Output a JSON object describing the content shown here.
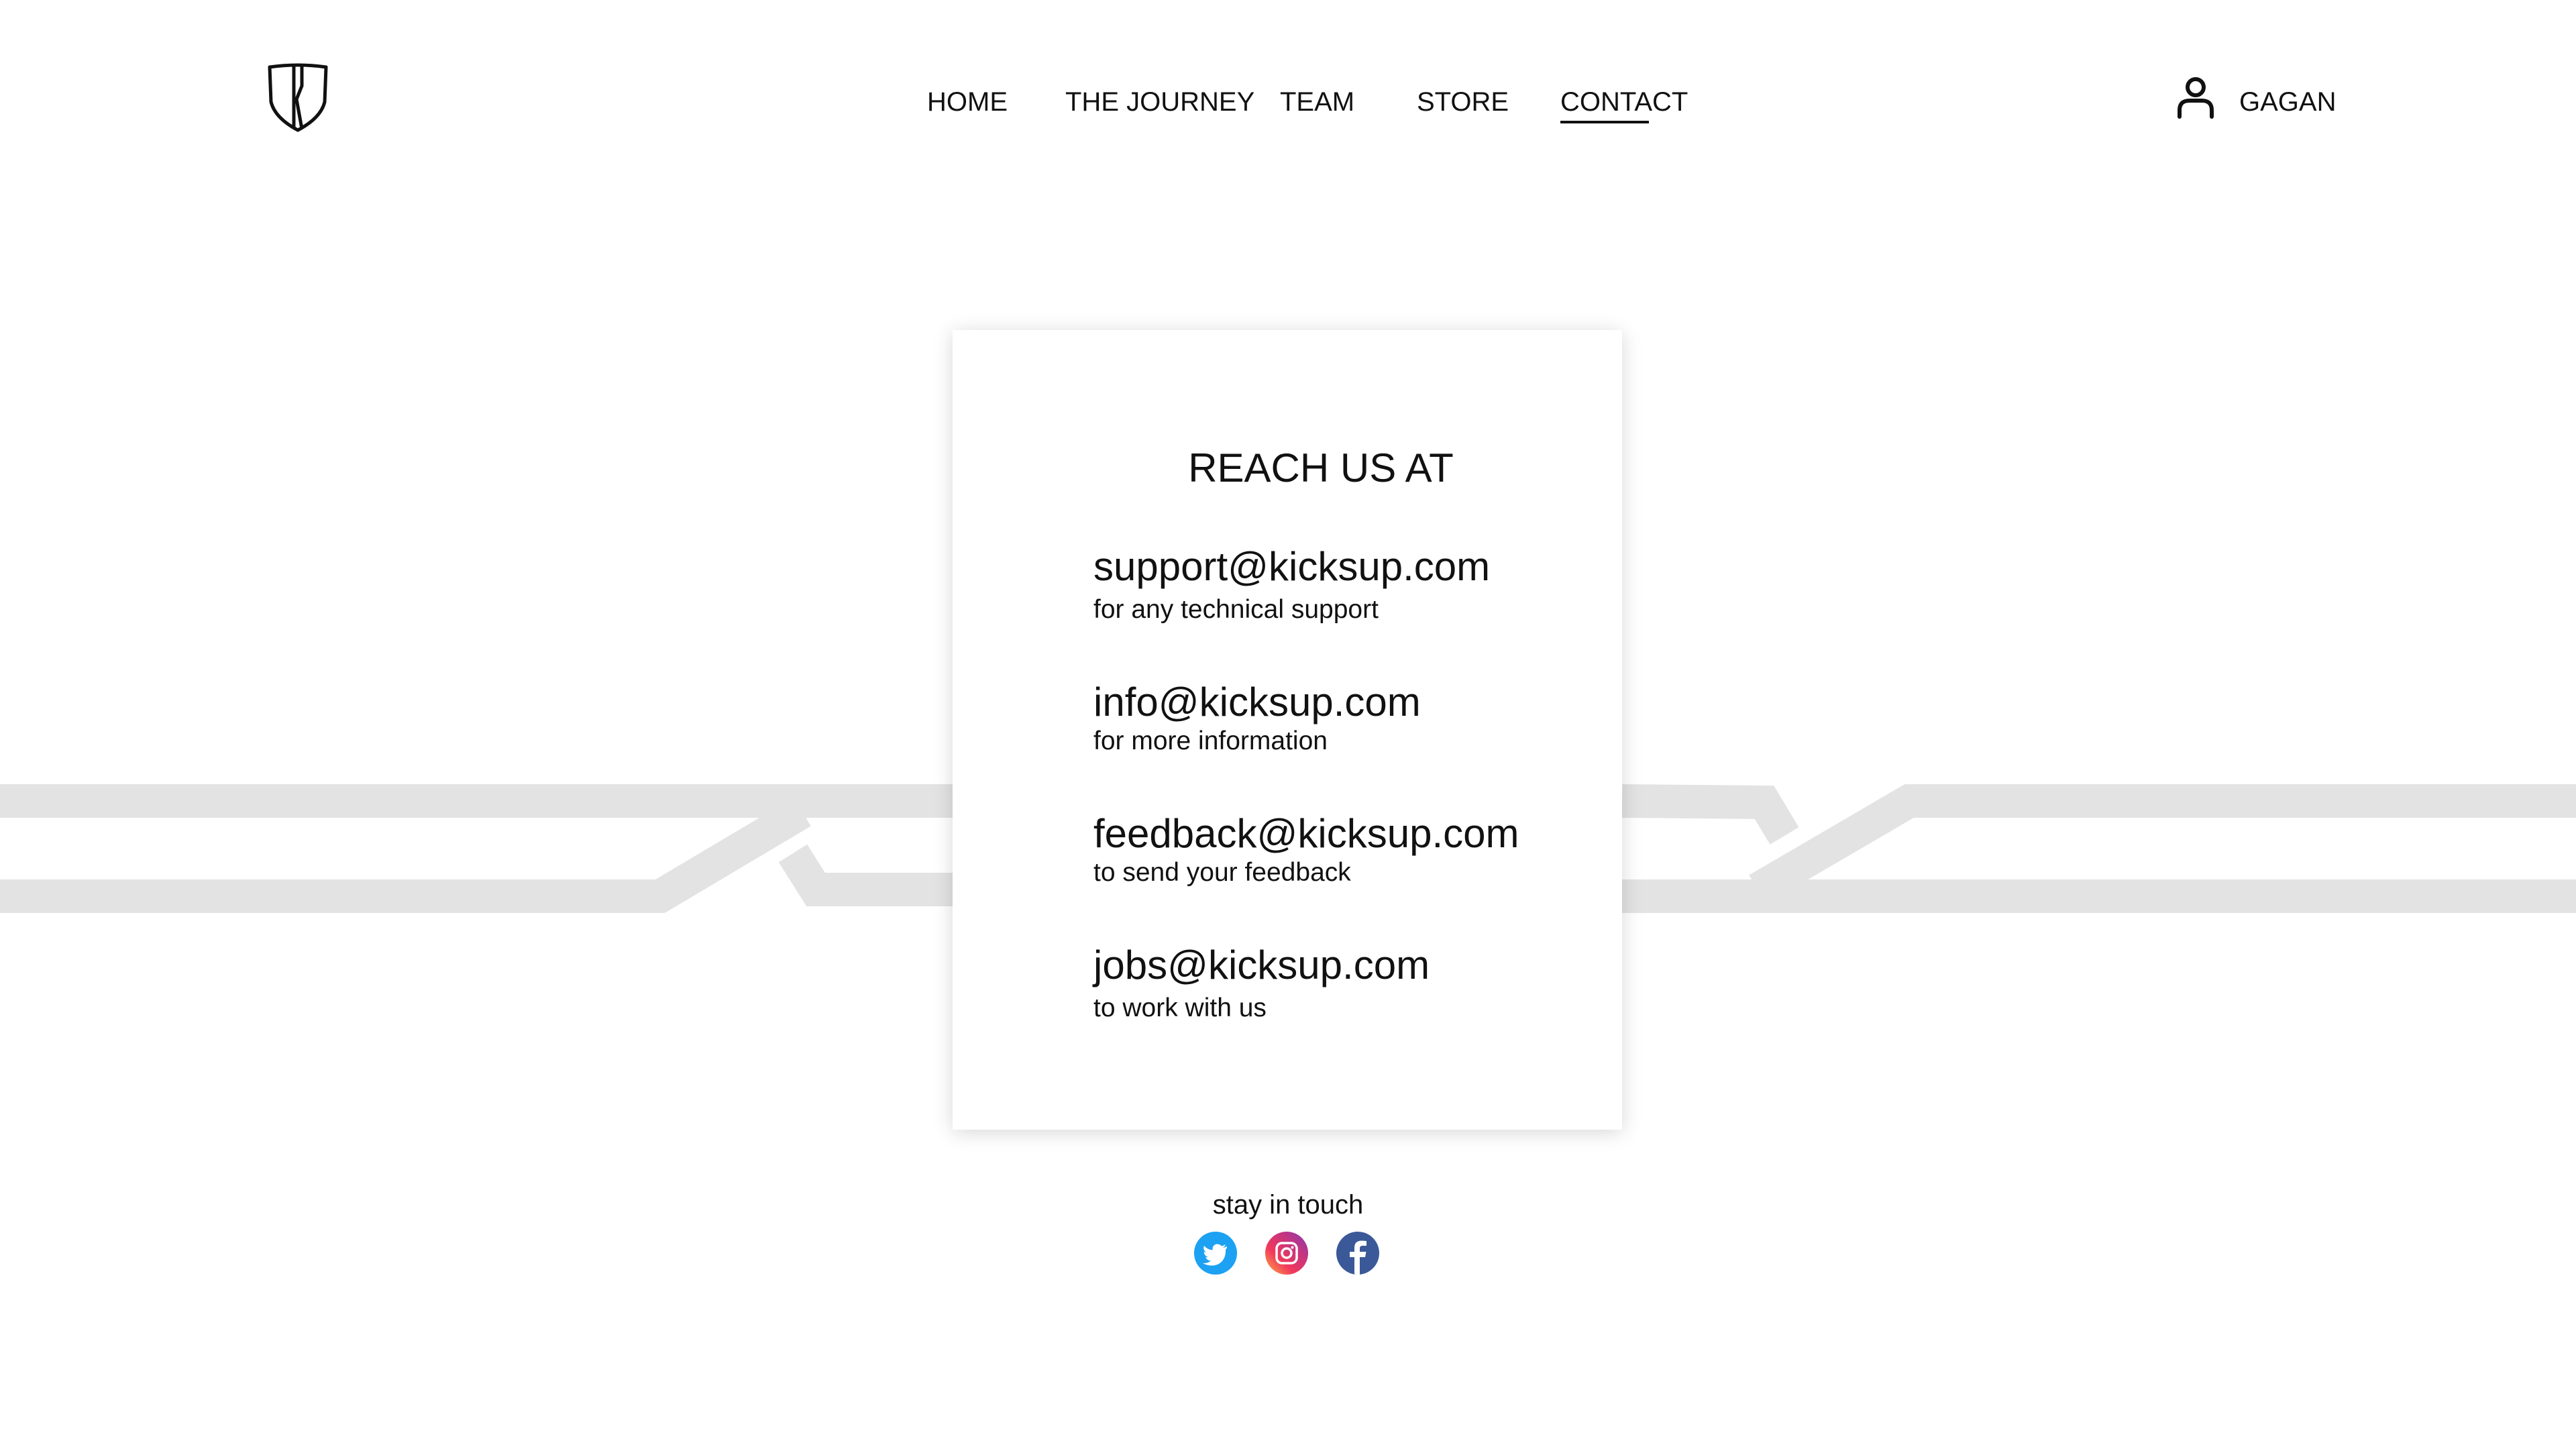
{
  "header": {
    "logo_icon": "shield-logo-icon",
    "nav": [
      {
        "label": "HOME"
      },
      {
        "label": "THE JOURNEY"
      },
      {
        "label": "TEAM"
      },
      {
        "label": "STORE"
      },
      {
        "label": "CONTACT",
        "active": true
      }
    ],
    "user": {
      "icon": "user-icon",
      "name": "GAGAN"
    }
  },
  "card": {
    "title": "REACH US AT",
    "contacts": [
      {
        "email": "support@kicksup.com",
        "description": "for any technical support"
      },
      {
        "email": "info@kicksup.com",
        "description": "for more information"
      },
      {
        "email": "feedback@kicksup.com",
        "description": "to send your feedback"
      },
      {
        "email": "jobs@kicksup.com",
        "description": "to work with us"
      }
    ]
  },
  "footer": {
    "stay_in_touch": "stay in touch",
    "social": [
      {
        "icon": "twitter-icon",
        "color": "#1DA1F2"
      },
      {
        "icon": "instagram-icon",
        "color": "#D6249F"
      },
      {
        "icon": "facebook-icon",
        "color": "#3B5998"
      }
    ]
  },
  "colors": {
    "text": "#111111",
    "background": "#ffffff",
    "track": "#e3e3e3"
  }
}
